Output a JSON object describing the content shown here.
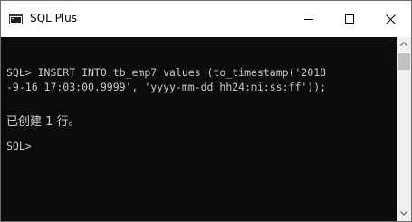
{
  "window": {
    "title": "SQL Plus",
    "icon": "console-window-icon",
    "controls": {
      "minimize": "minimize-icon",
      "maximize": "maximize-icon",
      "close": "close-icon"
    }
  },
  "console": {
    "lines": [
      "SQL> INSERT INTO tb_emp7 values (to_timestamp('2018",
      "-9-16 17:03:00.9999', 'yyyy-mm-dd hh24:mi:ss:ff'));",
      "已创建 1 行。",
      "SQL>"
    ]
  },
  "scrollbar": {
    "up_icon": "scroll-up-arrow-icon",
    "down_icon": "scroll-down-arrow-icon"
  },
  "colors": {
    "console_background": "#0c0c0c",
    "console_text": "#cccccc",
    "titlebar_background": "#ffffff",
    "scrollbar_track": "#f0f0f0",
    "scrollbar_thumb": "#c2c2c2"
  }
}
